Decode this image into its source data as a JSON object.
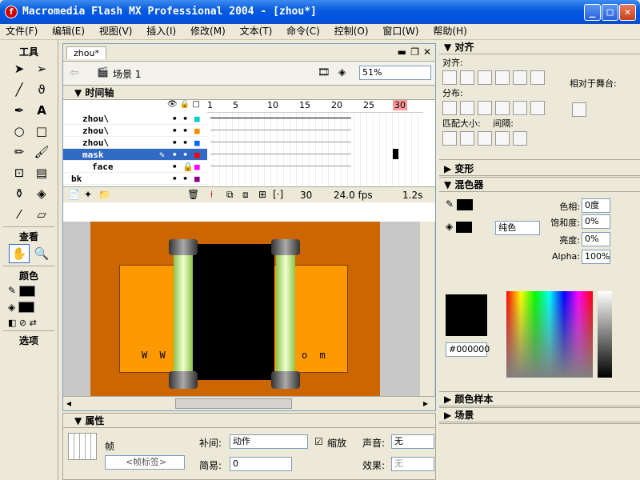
{
  "window": {
    "title": "Macromedia Flash MX Professional 2004 - [zhou*]",
    "app_icon": "f"
  },
  "menu": [
    "文件(F)",
    "编辑(E)",
    "视图(V)",
    "插入(I)",
    "修改(M)",
    "文本(T)",
    "命令(C)",
    "控制(O)",
    "窗口(W)",
    "帮助(H)"
  ],
  "tools": {
    "title": "工具",
    "view_label": "查看",
    "colors_label": "颜色",
    "options_label": "选项"
  },
  "document": {
    "tab": "zhou*",
    "scene": "场景 1",
    "zoom": "51%"
  },
  "timeline": {
    "title": "时间轴",
    "frame_ticks": [
      "1",
      "5",
      "10",
      "15",
      "20",
      "25",
      "30"
    ],
    "layers": [
      {
        "name": "zhou\\",
        "selected": false
      },
      {
        "name": "zhou\\",
        "selected": false
      },
      {
        "name": "zhou\\",
        "selected": false
      },
      {
        "name": "mask",
        "selected": true
      },
      {
        "name": "face",
        "selected": false
      },
      {
        "name": "bk",
        "selected": false
      }
    ],
    "current_frame": "30",
    "fps": "24.0 fps",
    "elapsed": "1.2s"
  },
  "stage": {
    "url_left": "W W W",
    "url_right": "o m"
  },
  "properties": {
    "title": "属性",
    "frame_label": "帧",
    "frame_label_placeholder": "<帧标签>",
    "tween_label": "补间:",
    "tween_value": "动作",
    "scale_label": "缩放",
    "ease_label": "简易:",
    "ease_value": "0",
    "sound_label": "声音:",
    "sound_value": "无",
    "effect_label": "效果:",
    "effect_value": "无"
  },
  "align_panel": {
    "title": "对齐",
    "align_label": "对齐:",
    "distribute_label": "分布:",
    "match_size_label": "匹配大小:",
    "spacing_label": "间隔:",
    "relative_label": "相对于舞台:"
  },
  "transform_panel": {
    "title": "变形"
  },
  "mixer_panel": {
    "title": "混色器",
    "type": "纯色",
    "hue_label": "色相:",
    "hue_value": "0度",
    "saturation_label": "饱和度:",
    "saturation_value": "0%",
    "brightness_label": "亮度:",
    "brightness_value": "0%",
    "alpha_label": "Alpha:",
    "alpha_value": "100%",
    "hex": "#000000"
  },
  "swatches_panel": {
    "title": "颜色样本"
  },
  "scene_panel": {
    "title": "场景"
  },
  "colors": {
    "titlebar": "#0054e3",
    "stage_bg": "#cc6600",
    "stage_inner": "#ff9900",
    "playhead": "#ff4444"
  }
}
